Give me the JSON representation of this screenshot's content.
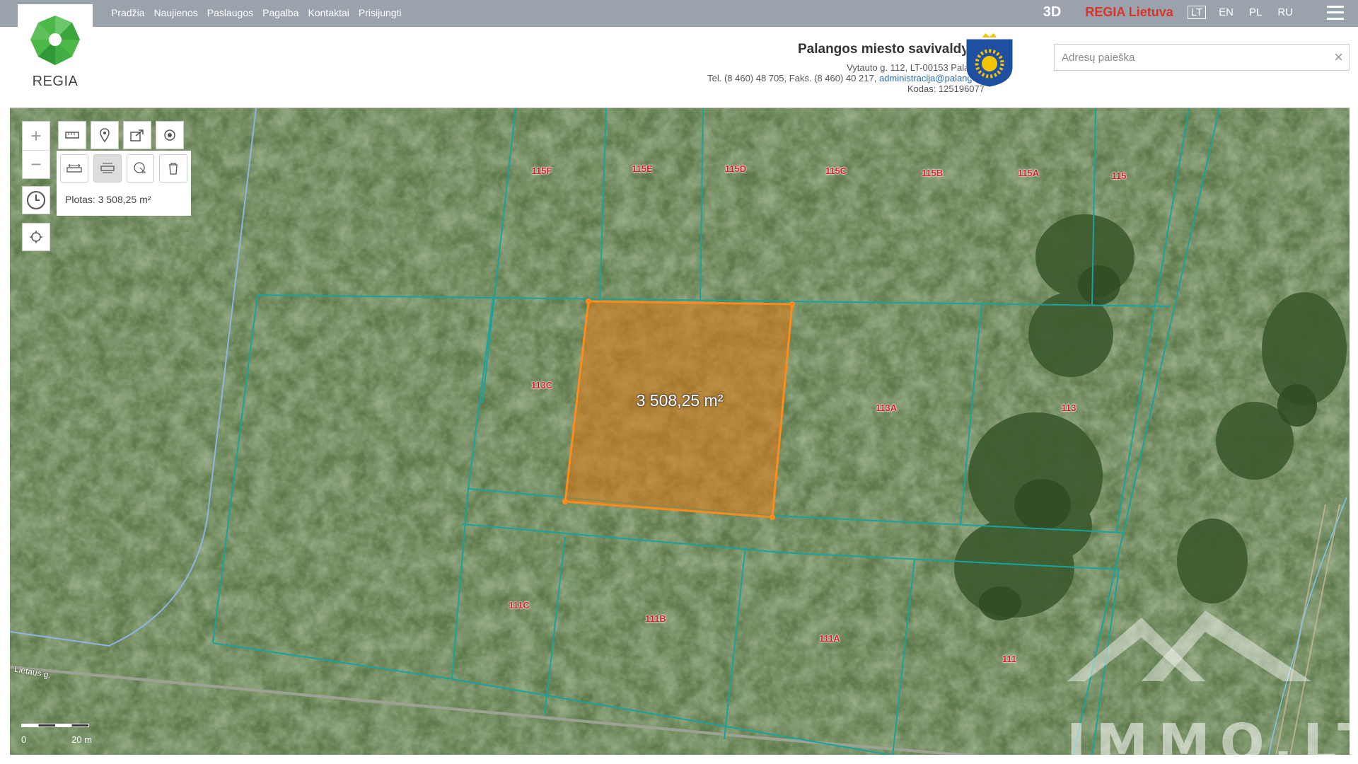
{
  "nav": {
    "items": [
      "Pradžia",
      "Naujienos",
      "Paslaugos",
      "Pagalba",
      "Kontaktai",
      "Prisijungti"
    ],
    "btn_3d": "3D",
    "brand": "REGIA Lietuva",
    "languages": [
      "LT",
      "EN",
      "PL",
      "RU"
    ],
    "active_language": "LT"
  },
  "logo": {
    "text": "REGIA"
  },
  "municipality": {
    "name": "Palangos miesto savivaldybė",
    "address": "Vytauto g. 112, LT-00153 Palanga",
    "phone": "Tel. (8 460) 48 705, Faks. (8 460) 40 217,",
    "email": "administracija@palanga.lt",
    "code": "Kodas: 125196077"
  },
  "search": {
    "placeholder": "Adresų paieška",
    "value": ""
  },
  "map": {
    "area_readout": "Plotas: 3 508,25 m²",
    "measurement_label": "3 508,25 m²",
    "street_label": "Lietaus g.",
    "scale": {
      "start": "0",
      "end": "20 m"
    },
    "parcel_labels": [
      "115F",
      "115E",
      "115D",
      "115C",
      "115B",
      "115A",
      "115",
      "113C",
      "113A",
      "113",
      "111C",
      "111B",
      "111A",
      "111"
    ],
    "colors": {
      "parcel_line": "#1aa7a0",
      "selection": "#ff8c1a",
      "label": "#d8212a"
    }
  },
  "watermark": {
    "text": "IMMO.LT"
  }
}
